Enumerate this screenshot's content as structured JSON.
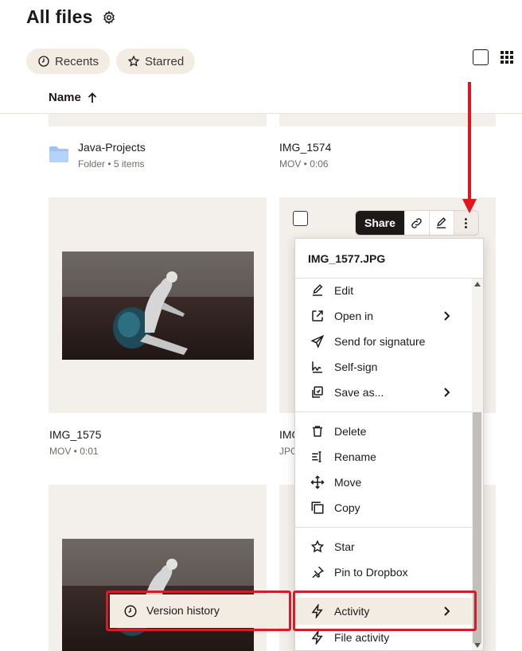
{
  "header": {
    "title": "All files",
    "settings_icon": "gear-icon"
  },
  "filters": [
    {
      "label": "Recents",
      "icon": "clock-icon"
    },
    {
      "label": "Starred",
      "icon": "star-icon"
    }
  ],
  "list_header": {
    "sort_label": "Name",
    "sort_direction_icon": "arrow-up-icon"
  },
  "files": [
    {
      "name": "Java-Projects",
      "meta": "Folder • 5 items"
    },
    {
      "name": "IMG_1574",
      "meta": "MOV • 0:06"
    },
    {
      "name": "IMG_1575",
      "meta": "MOV • 0:01"
    },
    {
      "name": "IMG_1577.JPG",
      "name_visible": "IMG",
      "meta_visible": "JPG"
    }
  ],
  "action_bar": {
    "share_label": "Share",
    "icons": [
      "link-icon",
      "edit-icon",
      "more-vertical-icon"
    ]
  },
  "context_menu": {
    "title": "IMG_1577.JPG",
    "groups": [
      [
        {
          "label": "Edit",
          "icon": "pencil-icon"
        },
        {
          "label": "Open in",
          "icon": "open-external-icon",
          "submenu": true
        },
        {
          "label": "Send for signature",
          "icon": "send-icon"
        },
        {
          "label": "Self-sign",
          "icon": "signature-icon"
        },
        {
          "label": "Save as...",
          "icon": "save-as-icon",
          "submenu": true
        }
      ],
      [
        {
          "label": "Delete",
          "icon": "trash-icon"
        },
        {
          "label": "Rename",
          "icon": "rename-icon"
        },
        {
          "label": "Move",
          "icon": "move-icon"
        },
        {
          "label": "Copy",
          "icon": "copy-icon"
        }
      ],
      [
        {
          "label": "Star",
          "icon": "star-icon"
        },
        {
          "label": "Pin to Dropbox",
          "icon": "pin-icon"
        }
      ],
      [
        {
          "label": "Activity",
          "icon": "lightning-icon",
          "submenu": true,
          "highlighted": true
        },
        {
          "label": "File activity",
          "icon": "lightning-icon"
        }
      ]
    ]
  },
  "submenu": {
    "label": "Version history",
    "icon": "clock-icon"
  },
  "annotations": {
    "color": "#d01f2a"
  }
}
